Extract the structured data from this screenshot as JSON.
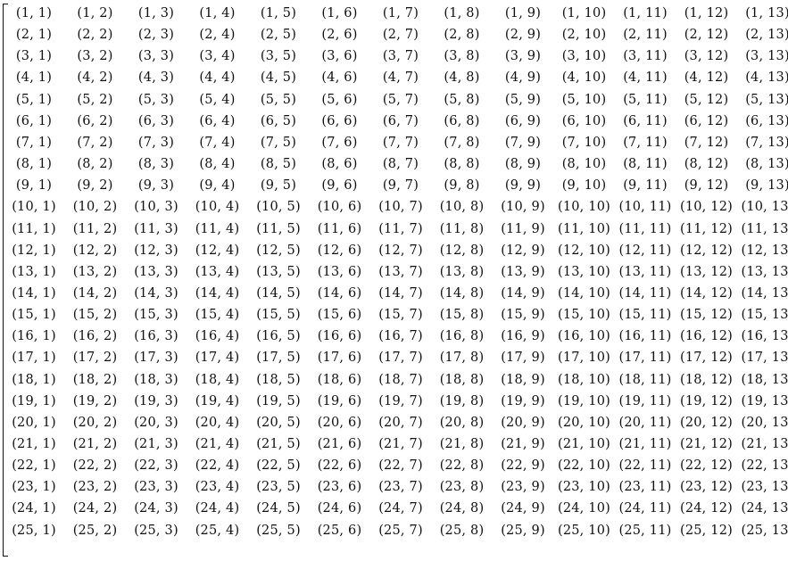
{
  "matrix": {
    "rows": 25,
    "cols": 13,
    "entry_format": "(i,j)"
  }
}
